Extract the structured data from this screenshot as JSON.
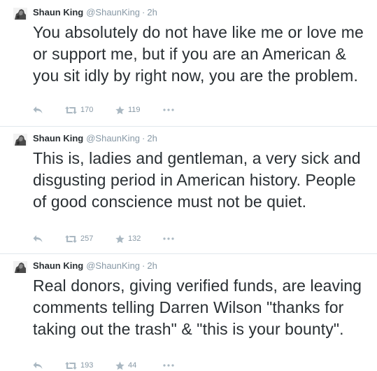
{
  "tweets": [
    {
      "name": "Shaun King",
      "handle": "@ShaunKing",
      "separator": "·",
      "time": "2h",
      "text": "You absolutely do not have like me or love me or support me, but if you are an American & you sit idly by right now, you are the problem.",
      "retweets": "170",
      "favorites": "119"
    },
    {
      "name": "Shaun King",
      "handle": "@ShaunKing",
      "separator": "·",
      "time": "2h",
      "text": "This is, ladies and gentleman, a very sick and disgusting period in American history. People of good conscience must not be quiet.",
      "retweets": "257",
      "favorites": "132"
    },
    {
      "name": "Shaun King",
      "handle": "@ShaunKing",
      "separator": "·",
      "time": "2h",
      "text": "Real donors, giving verified funds, are leaving comments telling Darren Wilson \"thanks for taking out the trash\" & \"this is your bounty\".",
      "retweets": "193",
      "favorites": "44"
    }
  ],
  "icons": {
    "reply": "reply-icon",
    "retweet": "retweet-icon",
    "favorite": "star-icon",
    "more": "more-dots-icon"
  },
  "colors": {
    "text": "#292f33",
    "meta": "#8899a6",
    "icon": "#aab8c2",
    "divider": "#e1e8ed"
  }
}
